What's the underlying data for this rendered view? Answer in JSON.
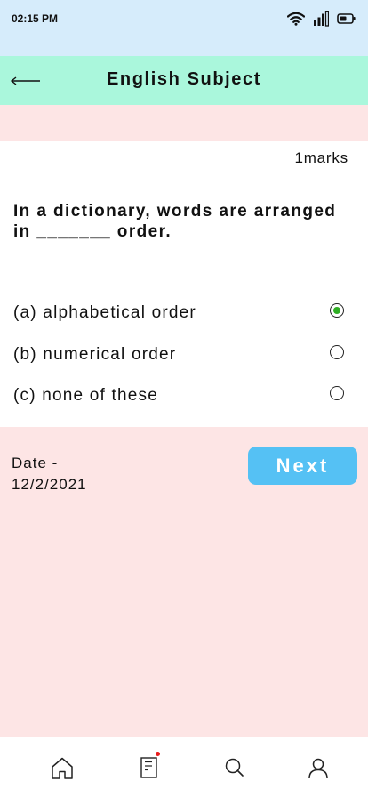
{
  "status_bar": {
    "time": "02:15 PM",
    "icons": [
      "wifi-icon",
      "signal-icon",
      "battery-icon"
    ]
  },
  "header": {
    "back_icon": "back-arrow-icon",
    "title": "English Subject",
    "background": "#aaf7dc"
  },
  "question": {
    "marks": "1marks",
    "text": "In a dictionary, words are arranged in _______ order.",
    "options": [
      {
        "label": "(a) alphabetical order",
        "selected": true
      },
      {
        "label": "(b) numerical order",
        "selected": false
      },
      {
        "label": "(c) none of these",
        "selected": false
      }
    ]
  },
  "footer": {
    "date_label": "Date -",
    "date_value": "12/2/2021",
    "next_label": "Next",
    "next_color": "#55c1f4"
  },
  "bottom_nav": {
    "items": [
      "home-icon",
      "notes-icon",
      "search-icon",
      "profile-icon"
    ],
    "notification_color": "#e81b1b"
  },
  "colors": {
    "page_background": "#fde5e5",
    "status_background": "#d6ecfb",
    "selected_radio": "#2fae24"
  }
}
